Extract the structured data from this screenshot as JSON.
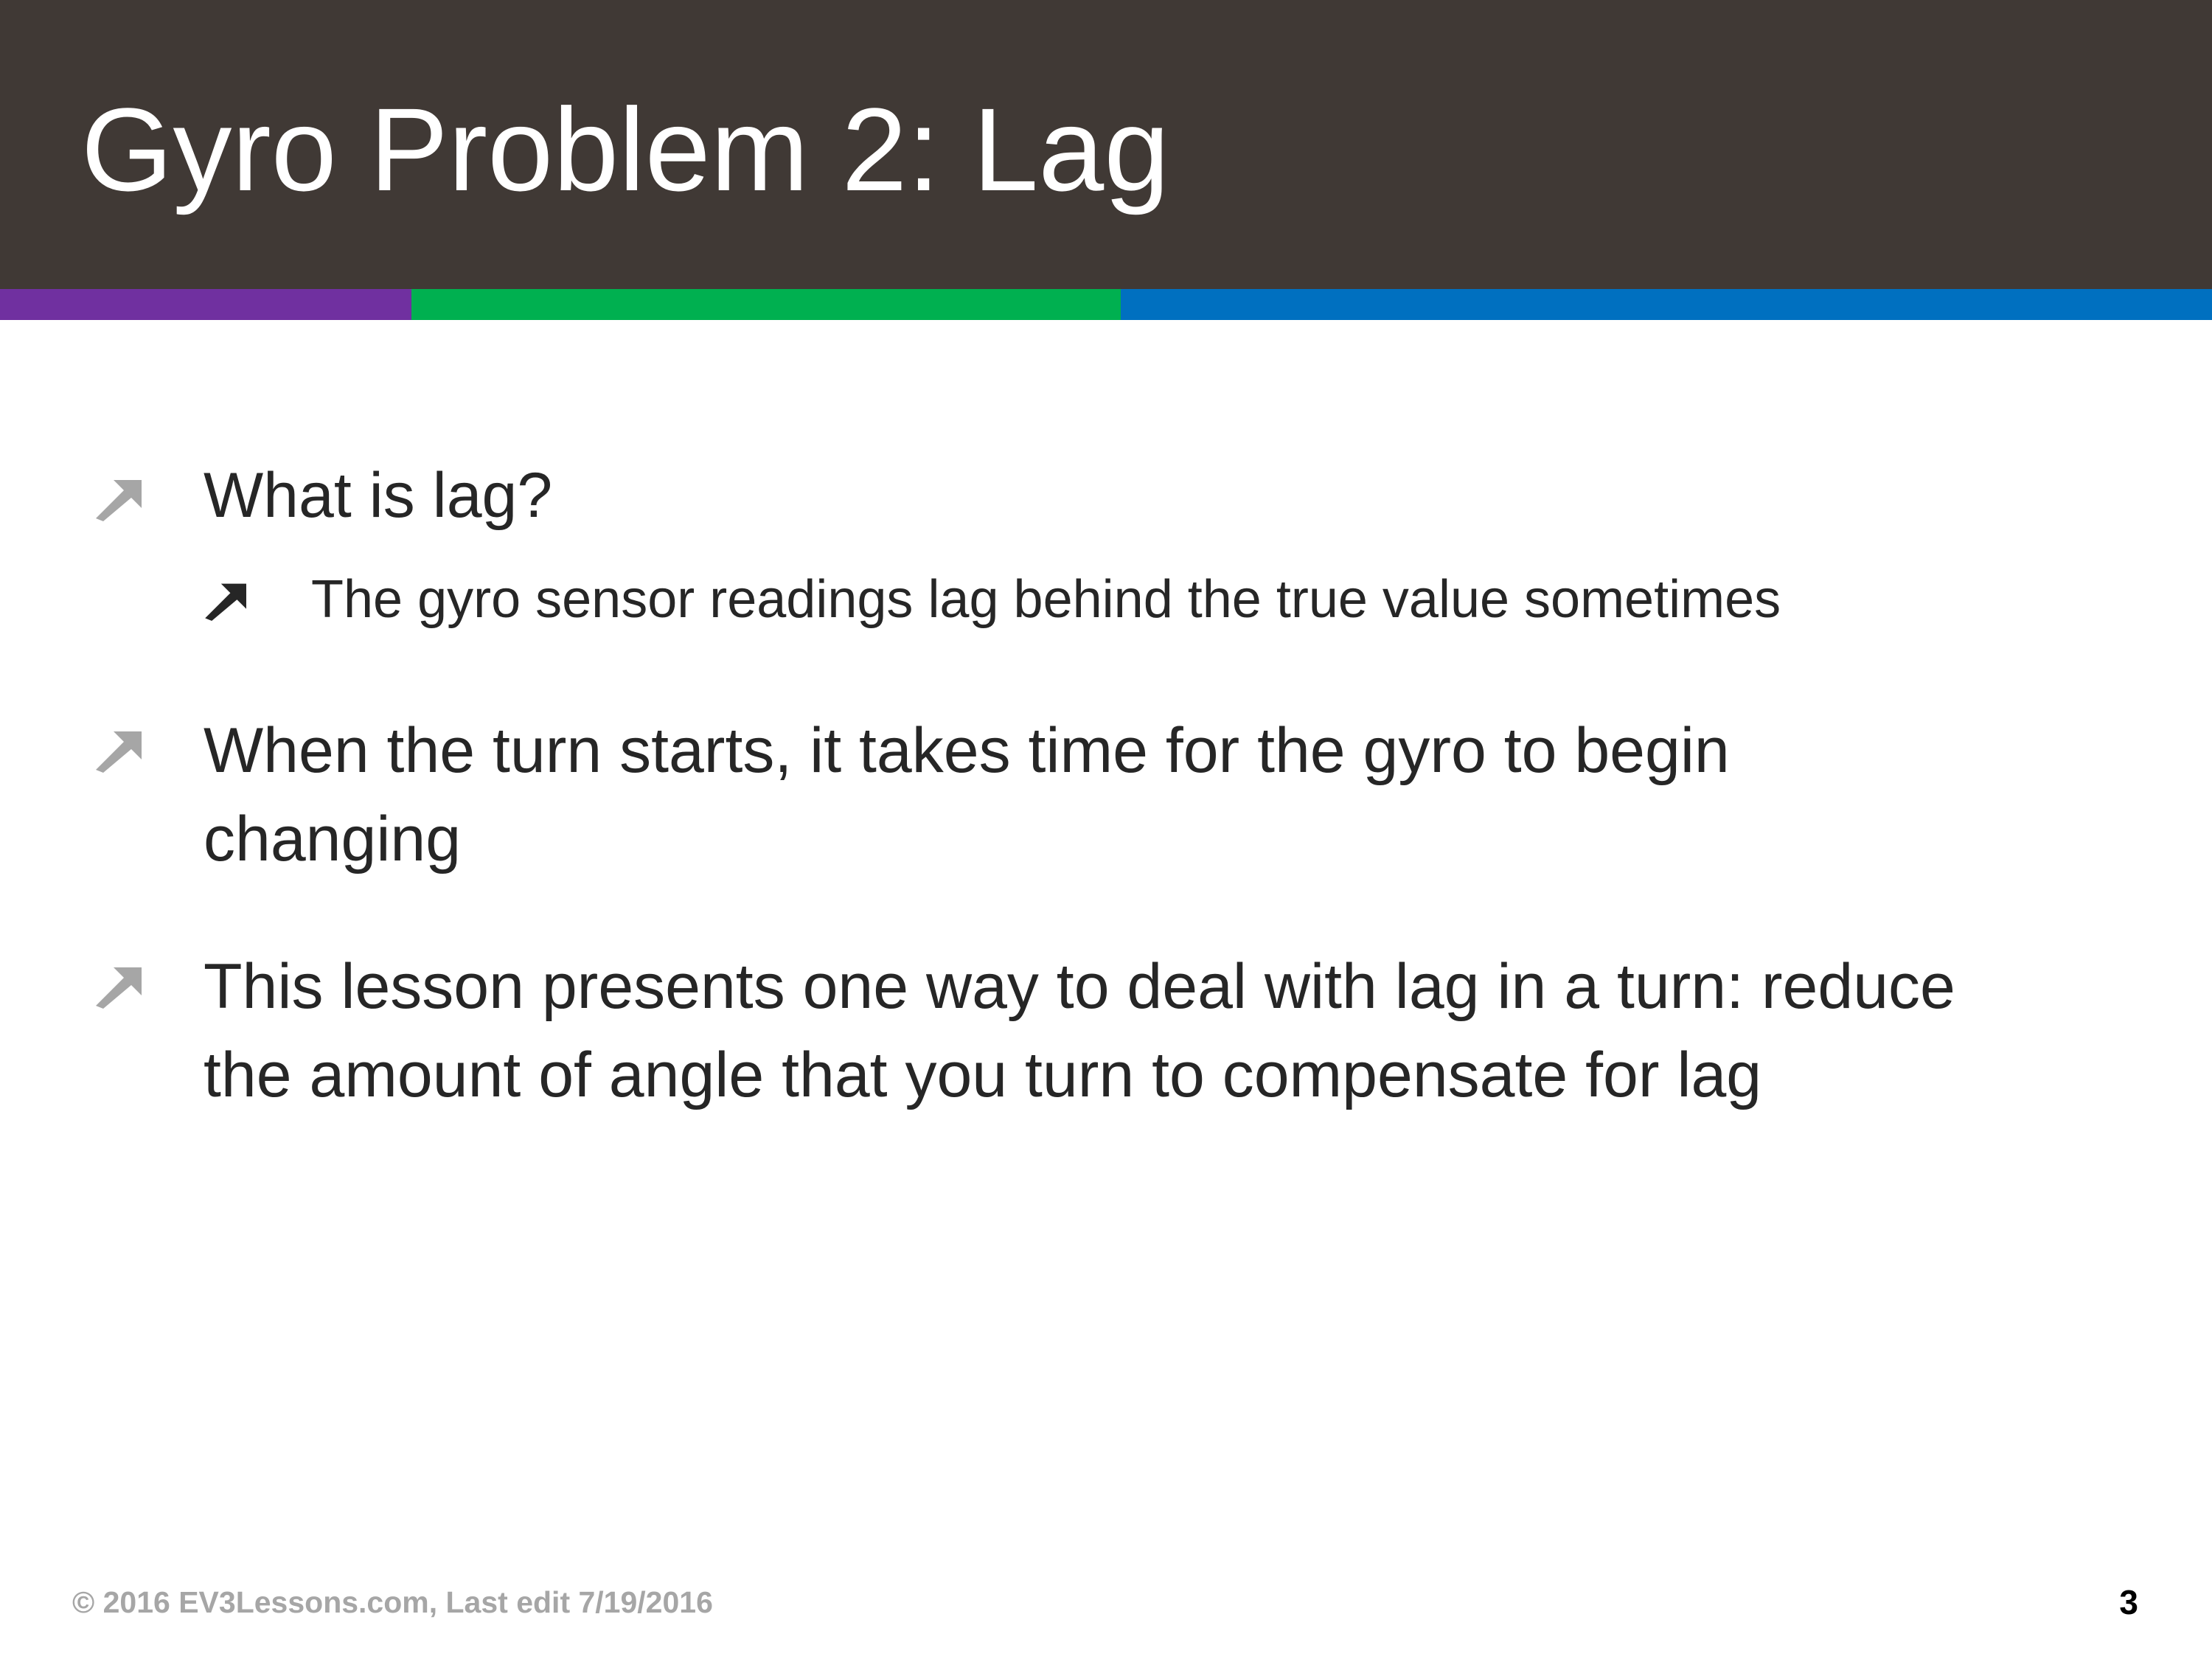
{
  "slide": {
    "title": "Gyro Problem 2: Lag",
    "colors": {
      "title_bar": "#403935",
      "stripe_purple": "#7030A0",
      "stripe_green": "#00B050",
      "stripe_blue": "#0070C0",
      "bullet_level1": "#a6a6a6",
      "bullet_level2": "#262626"
    },
    "bullets": [
      {
        "level": 1,
        "lines": [
          "What is lag?"
        ]
      },
      {
        "level": 2,
        "lines": [
          "The gyro sensor readings lag behind the true value sometimes"
        ]
      },
      {
        "level": 1,
        "lines": [
          "When the turn starts, it takes time for the gyro to begin",
          "changing"
        ]
      },
      {
        "level": 1,
        "lines": [
          "This lesson presents one way to deal with lag in a turn: reduce",
          "the amount of angle that you turn to compensate for lag"
        ]
      }
    ]
  },
  "footer": {
    "copyright": "© 2016 EV3Lessons.com, Last edit 7/19/2016",
    "page_number": "3"
  }
}
